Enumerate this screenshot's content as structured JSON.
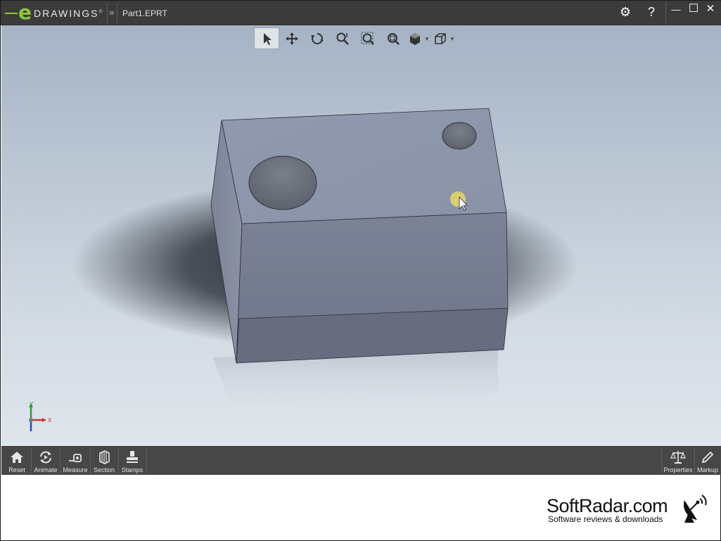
{
  "app": {
    "brand_prefix": "e",
    "brand_word": "DRAWINGS",
    "brand_mark": "®",
    "file_name": "Part1.EPRT",
    "breadcrumb_sep": "»"
  },
  "titlebar_buttons": {
    "settings": "⚙",
    "help": "?",
    "minimize": "—",
    "maximize": "☐",
    "close": "✕"
  },
  "view_toolbar": [
    "select-arrow-icon",
    "pan-icon",
    "rotate-icon",
    "zoom-icon",
    "zoom-to-area-icon",
    "zoom-to-fit-icon",
    "display-style-icon",
    "view-orientation-icon"
  ],
  "triad": {
    "x": "X",
    "y": "Y"
  },
  "bottom_toolbar": {
    "reset": "Reset",
    "animate": "Animate",
    "measure": "Measure",
    "section": "Section",
    "stamps": "Stamps",
    "properties": "Properties",
    "markup": "Markup"
  },
  "watermark": {
    "title": "SoftRadar.com",
    "subtitle": "Software reviews & downloads"
  },
  "colors": {
    "accent": "#8fc63d",
    "titlebar": "#3b3b3b",
    "toolbar": "#474747",
    "part_face": "#8e95ab"
  }
}
